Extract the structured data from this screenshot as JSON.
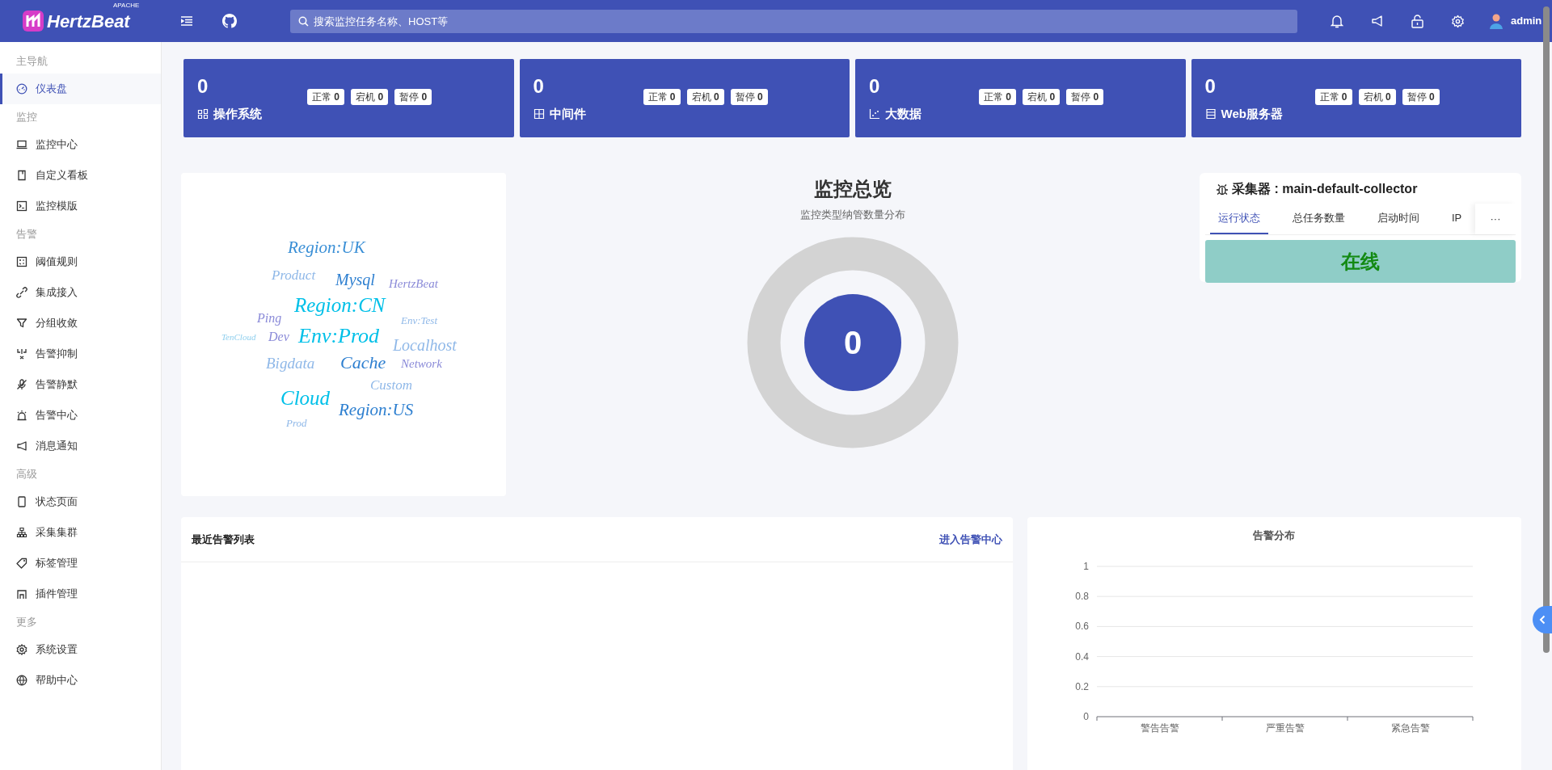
{
  "header": {
    "logo": "HertzBeat",
    "logo_badge": "APACHE",
    "search": {
      "placeholder": "搜索监控任务名称、HOST等"
    },
    "user": "admin"
  },
  "sidebar": {
    "sections": [
      {
        "title": "主导航",
        "items": [
          {
            "label": "仪表盘",
            "selected": true
          }
        ]
      },
      {
        "title": "监控",
        "items": [
          {
            "label": "监控中心",
            "selected": false
          },
          {
            "label": "自定义看板",
            "selected": false
          },
          {
            "label": "监控模版",
            "selected": false
          }
        ]
      },
      {
        "title": "告警",
        "items": [
          {
            "label": "阈值规则",
            "selected": false
          },
          {
            "label": "集成接入",
            "selected": false
          },
          {
            "label": "分组收敛",
            "selected": false
          },
          {
            "label": "告警抑制",
            "selected": false
          },
          {
            "label": "告警静默",
            "selected": false
          },
          {
            "label": "告警中心",
            "selected": false
          },
          {
            "label": "消息通知",
            "selected": false
          }
        ]
      },
      {
        "title": "高级",
        "items": [
          {
            "label": "状态页面",
            "selected": false
          },
          {
            "label": "采集集群",
            "selected": false
          },
          {
            "label": "标签管理",
            "selected": false
          },
          {
            "label": "插件管理",
            "selected": false
          }
        ]
      },
      {
        "title": "更多",
        "items": [
          {
            "label": "系统设置",
            "selected": false
          },
          {
            "label": "帮助中心",
            "selected": false
          }
        ]
      }
    ]
  },
  "stat_cards": [
    {
      "count": "0",
      "label": "操作系统",
      "badges": [
        {
          "label": "正常",
          "count": "0"
        },
        {
          "label": "宕机",
          "count": "0"
        },
        {
          "label": "暂停",
          "count": "0"
        }
      ]
    },
    {
      "count": "0",
      "label": "中间件",
      "badges": [
        {
          "label": "正常",
          "count": "0"
        },
        {
          "label": "宕机",
          "count": "0"
        },
        {
          "label": "暂停",
          "count": "0"
        }
      ]
    },
    {
      "count": "0",
      "label": "大数据",
      "badges": [
        {
          "label": "正常",
          "count": "0"
        },
        {
          "label": "宕机",
          "count": "0"
        },
        {
          "label": "暂停",
          "count": "0"
        }
      ]
    },
    {
      "count": "0",
      "label": "Web服务器",
      "badges": [
        {
          "label": "正常",
          "count": "0"
        },
        {
          "label": "宕机",
          "count": "0"
        },
        {
          "label": "暂停",
          "count": "0"
        }
      ]
    }
  ],
  "tag_cloud": [
    {
      "text": "Region:UK",
      "color": "#3a8fd6"
    },
    {
      "text": "Product",
      "color": "#8fb8e8"
    },
    {
      "text": "Mysql",
      "color": "#2d7fd0"
    },
    {
      "text": "HertzBeat",
      "color": "#8a8ad8"
    },
    {
      "text": "Region:CN",
      "color": "#00c0e8"
    },
    {
      "text": "Ping",
      "color": "#8a8ad8"
    },
    {
      "text": "Env:Test",
      "color": "#8fb8e8"
    },
    {
      "text": "TenCloud",
      "color": "#8fcfee"
    },
    {
      "text": "Dev",
      "color": "#8a8ad8"
    },
    {
      "text": "Env:Prod",
      "color": "#00c0e8"
    },
    {
      "text": "Localhost",
      "color": "#8fb8e8"
    },
    {
      "text": "Bigdata",
      "color": "#8fb8e8"
    },
    {
      "text": "Cache",
      "color": "#2d7fd0"
    },
    {
      "text": "Network",
      "color": "#8a8ad8"
    },
    {
      "text": "Custom",
      "color": "#8fb8e8"
    },
    {
      "text": "Cloud",
      "color": "#00c0e8"
    },
    {
      "text": "Region:US",
      "color": "#2d7fd0"
    },
    {
      "text": "Prod",
      "color": "#8fb8e8"
    }
  ],
  "overview": {
    "title": "监控总览",
    "subtitle": "监控类型纳管数量分布",
    "total": "0"
  },
  "collector": {
    "title": "采集器 : main-default-collector",
    "tabs": [
      {
        "label": "运行状态",
        "selected": true
      },
      {
        "label": "总任务数量",
        "selected": false
      },
      {
        "label": "启动时间",
        "selected": false
      },
      {
        "label": "IP",
        "selected": false
      }
    ],
    "more": "···",
    "status": "在线",
    "online": true
  },
  "recent_alerts": {
    "title": "最近告警列表",
    "link": "进入告警中心"
  },
  "alert_distribution": {
    "chart_data": {
      "type": "bar",
      "title": "告警分布",
      "categories": [
        "警告告警",
        "严重告警",
        "紧急告警"
      ],
      "values": [
        0,
        0,
        0
      ],
      "grid": true,
      "ylim": [
        0,
        1
      ],
      "yticks": [
        0,
        0.2,
        0.4,
        0.6,
        0.8,
        1
      ]
    }
  }
}
